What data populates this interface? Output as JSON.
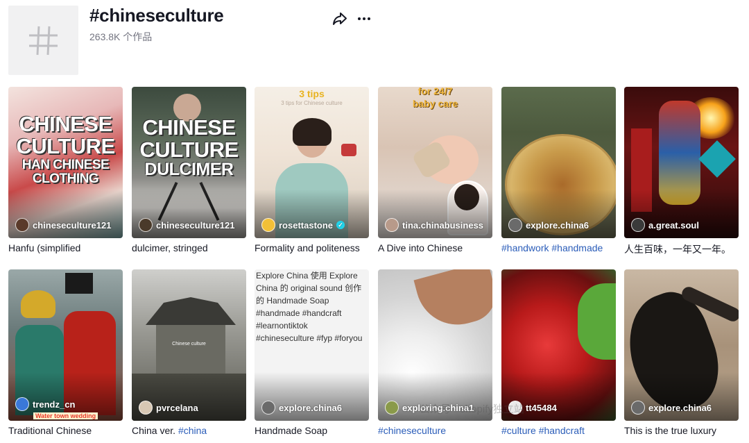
{
  "header": {
    "title": "#chineseculture",
    "count": "263.8K 个作品",
    "hashtag_icon": "hashtag-icon",
    "share_icon": "share-icon",
    "more_icon": "more-icon"
  },
  "row1": [
    {
      "author": "chineseculture121",
      "caption": "Hanfu (simplified",
      "overlay": [
        "CHINESE",
        "CULTURE",
        "HAN CHINESE",
        "CLOTHING"
      ]
    },
    {
      "author": "chineseculture121",
      "caption": "dulcimer, stringed",
      "overlay": [
        "CHINESE",
        "CULTURE",
        "DULCIMER"
      ]
    },
    {
      "author": "rosettastone",
      "caption": "Formality and politeness",
      "top_text": "3 tips",
      "sub_text": "3 tips for Chinese culture"
    },
    {
      "author": "tina.chinabusiness",
      "caption": "A Dive into Chinese",
      "top_text": "for 24/7",
      "sub_text": "baby care"
    },
    {
      "author": "explore.china6",
      "caption_tags": "#handwork #handmade"
    },
    {
      "author": "a.great.soul",
      "caption": "人生百味，一年又一年。"
    }
  ],
  "row2": [
    {
      "author": "trendz_cn",
      "caption": "Traditional Chinese",
      "banner": "Water town wedding"
    },
    {
      "author": "pvrcelana",
      "caption": "China ver.",
      "caption_tag": "#china",
      "inner_text": "Chinese culture"
    },
    {
      "author": "explore.china6",
      "caption": "Handmade Soap",
      "alt": "Explore China 使用 Explore China 的 original sound 创作的 Handmade Soap #handmade #handcraft #learnontiktok #chineseculture #fyp #foryou"
    },
    {
      "author": "exploring.china1",
      "caption_tags": "#chineseculture"
    },
    {
      "author": "tt45484",
      "caption_tags": "#culture #handcraft"
    },
    {
      "author": "explore.china6",
      "caption": "This is the true luxury"
    }
  ],
  "watermark": "公众号 · shopify独立站"
}
